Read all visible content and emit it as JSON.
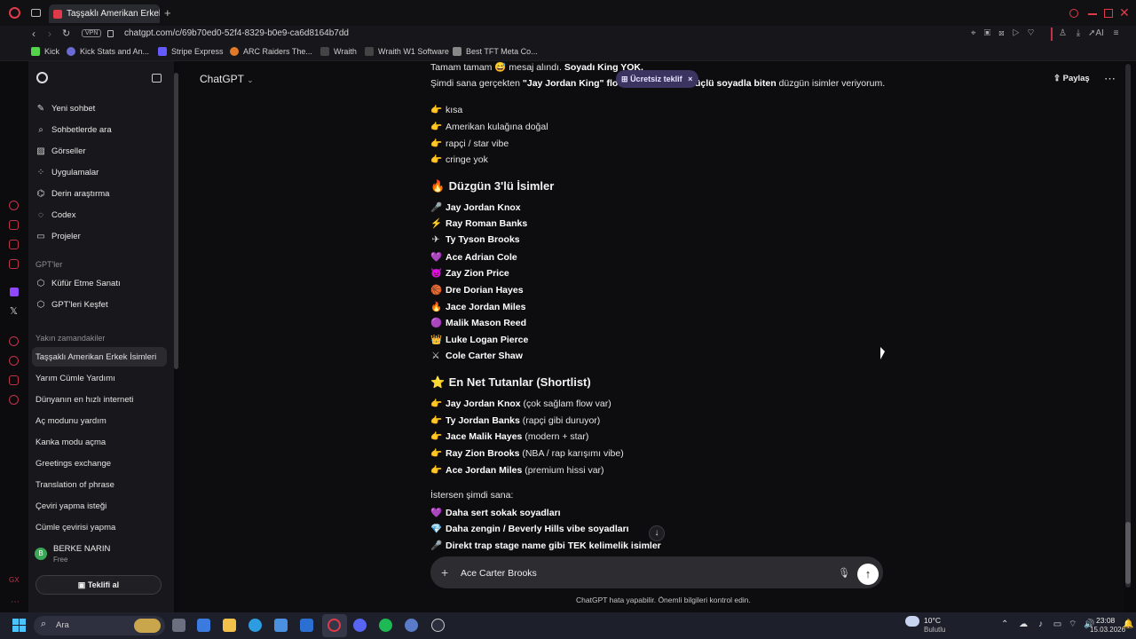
{
  "browser": {
    "tab_title": "Taşşaklı Amerikan Erkek İs",
    "new_tab": "+",
    "vpn": "VPN",
    "url": "chatgpt.com/c/69b70ed0-52f4-8329-b0e9-ca6d8164b7dd",
    "ai_label": "AI",
    "bookmarks": [
      "Kick",
      "Kick Stats and An...",
      "Stripe Express",
      "ARC Raiders The...",
      "Wraith",
      "Wraith W1 Software",
      "Best TFT Meta Co..."
    ]
  },
  "sidebar": {
    "nav": [
      {
        "label": "Yeni sohbet",
        "icon": "edit-icon"
      },
      {
        "label": "Sohbetlerde ara",
        "icon": "search-icon"
      },
      {
        "label": "Görseller",
        "icon": "image-icon"
      },
      {
        "label": "Uygulamalar",
        "icon": "apps-icon"
      },
      {
        "label": "Derin araştırma",
        "icon": "telescope-icon"
      },
      {
        "label": "Codex",
        "icon": "codex-icon"
      },
      {
        "label": "Projeler",
        "icon": "folder-icon"
      }
    ],
    "gpts_header": "GPT'ler",
    "gpts": [
      "Küfür Etme Sanatı",
      "GPT'leri Keşfet"
    ],
    "recent_header": "Yakın zamandakiler",
    "recent": [
      "Taşşaklı Amerikan Erkek İsimleri",
      "Yarım Cümle Yardımı",
      "Dünyanın en hızlı interneti",
      "Aç modunu yardım",
      "Kanka modu açma",
      "Greetings exchange",
      "Translation of phrase",
      "Çeviri yapma isteği",
      "Cümle çevirisi yapma"
    ],
    "user": {
      "initial": "B",
      "name": "BERKE NARIN",
      "plan": "Free"
    },
    "offer_button": "Teklifi al"
  },
  "header": {
    "model": "ChatGPT",
    "promo": "Ücretsiz teklif",
    "promo_close": "×",
    "share": "Paylaş",
    "more": "⋯"
  },
  "chat": {
    "intro1_pre": "Tamam tamam ",
    "intro1_mid": " mesaj alındı. ",
    "intro1_bold": "Soyadı King YOK.",
    "intro2_pre": "Şimdi sana gerçekten ",
    "intro2_bold1": "\"Jay Jordan King\" flow",
    "intro2_bold2": "üçlü soyadla biten",
    "intro2_post": " düzgün isimler veriyorum.",
    "criteria": [
      "kısa",
      "Amerikan kulağına doğal",
      "rapçi / star vibe",
      "cringe yok"
    ],
    "section1_title": "Düzgün 3'lü İsimler",
    "names": [
      {
        "emoji": "🎤",
        "name": "Jay Jordan Knox"
      },
      {
        "emoji": "⚡",
        "name": "Ray Roman Banks"
      },
      {
        "emoji": "✈",
        "name": "Ty Tyson Brooks"
      },
      {
        "emoji": "💜",
        "name": "Ace Adrian Cole"
      },
      {
        "emoji": "😈",
        "name": "Zay Zion Price"
      },
      {
        "emoji": "🏀",
        "name": "Dre Dorian Hayes"
      },
      {
        "emoji": "🔥",
        "name": "Jace Jordan Miles"
      },
      {
        "emoji": "🟣",
        "name": "Malik Mason Reed"
      },
      {
        "emoji": "👑",
        "name": "Luke Logan Pierce"
      },
      {
        "emoji": "⚔",
        "name": "Cole Carter Shaw"
      }
    ],
    "section2_title": "En Net Tutanlar (Shortlist)",
    "shortlist": [
      {
        "name": "Jay Jordan Knox",
        "note": " (çok sağlam flow var)"
      },
      {
        "name": "Ty Jordan Banks",
        "note": " (rapçi gibi duruyor)"
      },
      {
        "name": "Jace Malik Hayes",
        "note": " (modern + star)"
      },
      {
        "name": "Ray Zion Brooks",
        "note": " (NBA / rap karışımı vibe)"
      },
      {
        "name": "Ace Jordan Miles",
        "note": " (premium hissi var)"
      }
    ],
    "offer_intro": "İstersen şimdi sana:",
    "offers": [
      {
        "emoji": "💜",
        "text": "Daha sert sokak soyadları"
      },
      {
        "emoji": "💎",
        "text": "Daha zengin / Beverly Hills vibe soyadları"
      },
      {
        "emoji": "🎤",
        "text": "Direkt trap stage name gibi TEK kelimelik isimler"
      }
    ]
  },
  "composer": {
    "value": "Ace Carter Brooks",
    "disclaimer": "ChatGPT hata yapabilir. Önemli bilgileri kontrol edin."
  },
  "taskbar": {
    "search": "Ara",
    "weather_temp": "10°C",
    "weather_desc": "Bulutlu",
    "time": "23:08",
    "date": "15.03.2026"
  },
  "colors": {
    "opera_red": "#e03a4a",
    "accent_promo": "#3b3360"
  }
}
